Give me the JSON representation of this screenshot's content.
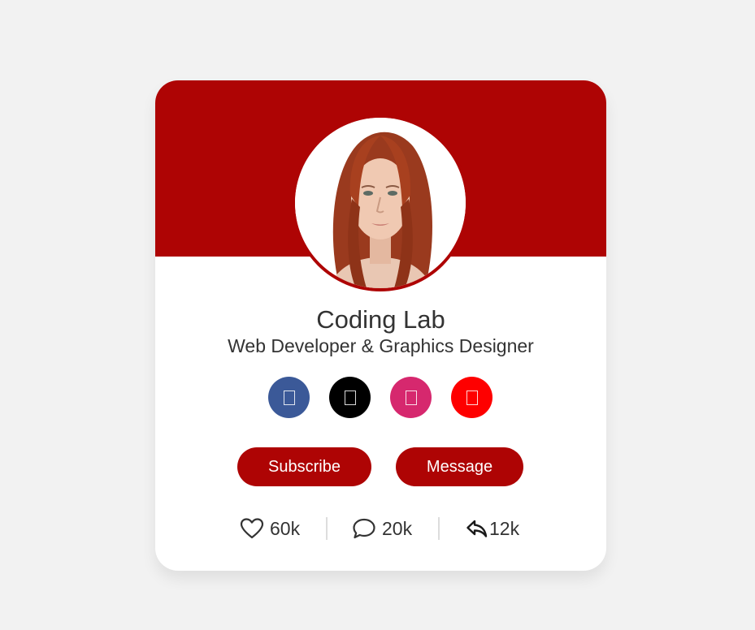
{
  "profile": {
    "name": "Coding Lab",
    "job": "Web Developer & Graphics Designer"
  },
  "socials": [
    {
      "icon": "facebook-icon",
      "color": "#3b5998",
      "glyph": ""
    },
    {
      "icon": "twitter-icon",
      "color": "#000000",
      "glyph": ""
    },
    {
      "icon": "instagram-icon",
      "color": "#d6286e",
      "glyph": ""
    },
    {
      "icon": "youtube-icon",
      "color": "#fe0000",
      "glyph": ""
    }
  ],
  "buttons": {
    "subscribe": "Subscribe",
    "message": "Message"
  },
  "stats": {
    "likes": "60k",
    "comments": "20k",
    "shares": "12k"
  },
  "colors": {
    "accent": "#ae0404",
    "background": "#f2f2f2",
    "card": "#ffffff",
    "text": "#333333"
  }
}
